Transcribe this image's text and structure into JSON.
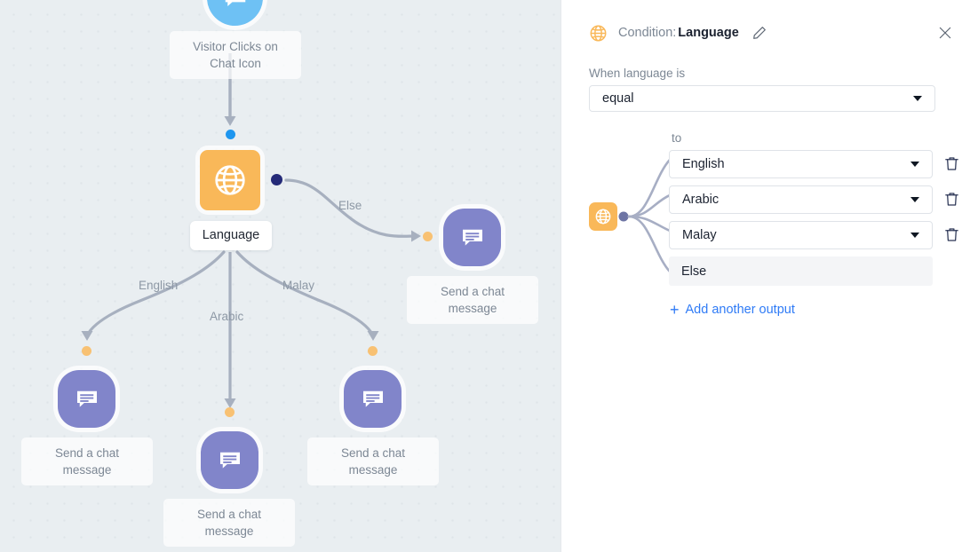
{
  "canvas": {
    "nodes": [
      {
        "id": "trigger",
        "icon": "chat-bubble-trigger-icon",
        "label": "Visitor Clicks on\nChat Icon",
        "label_line1": "Visitor Clicks on",
        "label_line2": "Chat Icon"
      },
      {
        "id": "condition",
        "icon": "globe-icon",
        "label": "Language"
      },
      {
        "id": "msg-else",
        "icon": "chat-message-icon",
        "label_line1": "Send a chat",
        "label_line2": "message"
      },
      {
        "id": "msg-english",
        "icon": "chat-message-icon",
        "label_line1": "Send a chat",
        "label_line2": "message"
      },
      {
        "id": "msg-arabic",
        "icon": "chat-message-icon",
        "label_line1": "Send a chat",
        "label_line2": "message"
      },
      {
        "id": "msg-malay",
        "icon": "chat-message-icon",
        "label_line1": "Send a chat",
        "label_line2": "message"
      }
    ],
    "edge_labels": {
      "else": "Else",
      "english": "English",
      "arabic": "Arabic",
      "malay": "Malay"
    },
    "colors": {
      "background": "#e9eef1",
      "condition_node": "#f9b859",
      "message_node": "#8185ca",
      "trigger_node": "#6ec1f4",
      "port_in": "#1e96ef",
      "port_out": "#242a78",
      "port_branch": "#f8c173",
      "edge": "#a7b0bf"
    }
  },
  "panel": {
    "header": {
      "icon": "globe-icon",
      "prefix": "Condition:",
      "title": "Language",
      "edit_icon": "pencil-icon",
      "close_icon": "close-icon"
    },
    "condition": {
      "label": "When language is",
      "operator_value": "equal",
      "operator_options": [
        "equal"
      ]
    },
    "outputs": {
      "to_label": "to",
      "icon": "globe-icon",
      "rows": [
        {
          "value": "English",
          "delete_icon": "trash-icon",
          "deletable": true
        },
        {
          "value": "Arabic",
          "delete_icon": "trash-icon",
          "deletable": true
        },
        {
          "value": "Malay",
          "delete_icon": "trash-icon",
          "deletable": true
        }
      ],
      "else_row": {
        "value": "Else",
        "deletable": false
      },
      "add_label": "Add another output",
      "add_icon": "plus-icon"
    },
    "colors": {
      "accent_link": "#2f7bf6",
      "border": "#dfe3e8",
      "muted_text": "#7c8794",
      "else_bg": "#f4f5f7"
    }
  }
}
